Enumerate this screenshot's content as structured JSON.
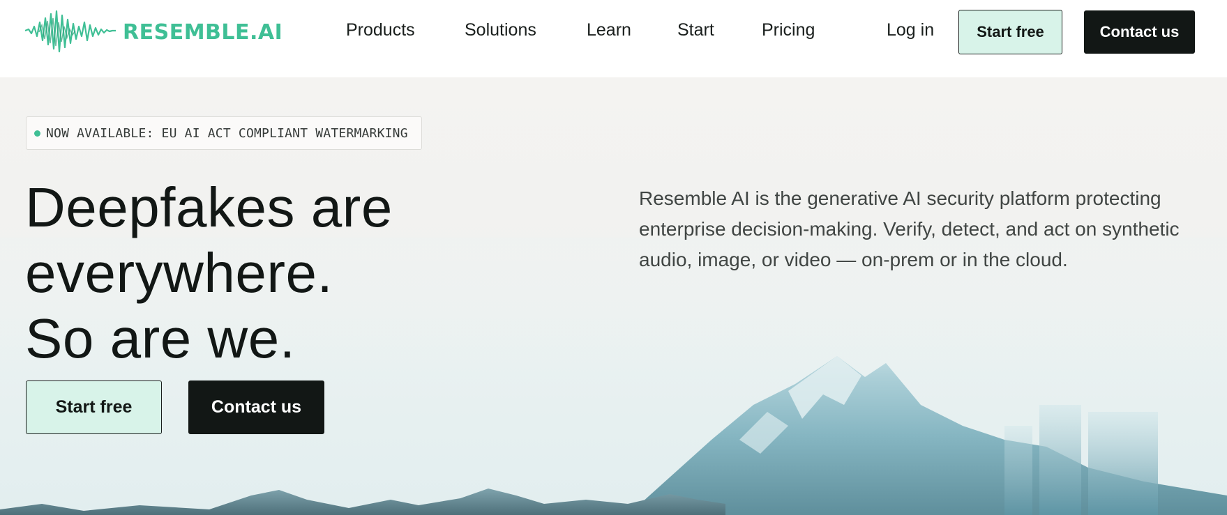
{
  "brand": {
    "name": "RESEMBLE.AI",
    "accent": "#3fbf95",
    "dark": "#121715",
    "light_button": "#d8f3e9"
  },
  "nav": {
    "links": [
      "Products",
      "Solutions",
      "Learn",
      "Start",
      "Pricing"
    ],
    "login": "Log in",
    "start_free": "Start free",
    "contact": "Contact us"
  },
  "hero": {
    "badge": "NOW AVAILABLE: EU AI ACT COMPLIANT WATERMARKING",
    "headline": [
      "Deepfakes are",
      "everywhere.",
      "So are we."
    ],
    "description": "Resemble AI is the generative AI security platform protecting enterprise decision-making. Verify, detect, and act on synthetic audio, image, or video — on-prem or in the cloud.",
    "start_free": "Start free",
    "contact": "Contact us"
  }
}
